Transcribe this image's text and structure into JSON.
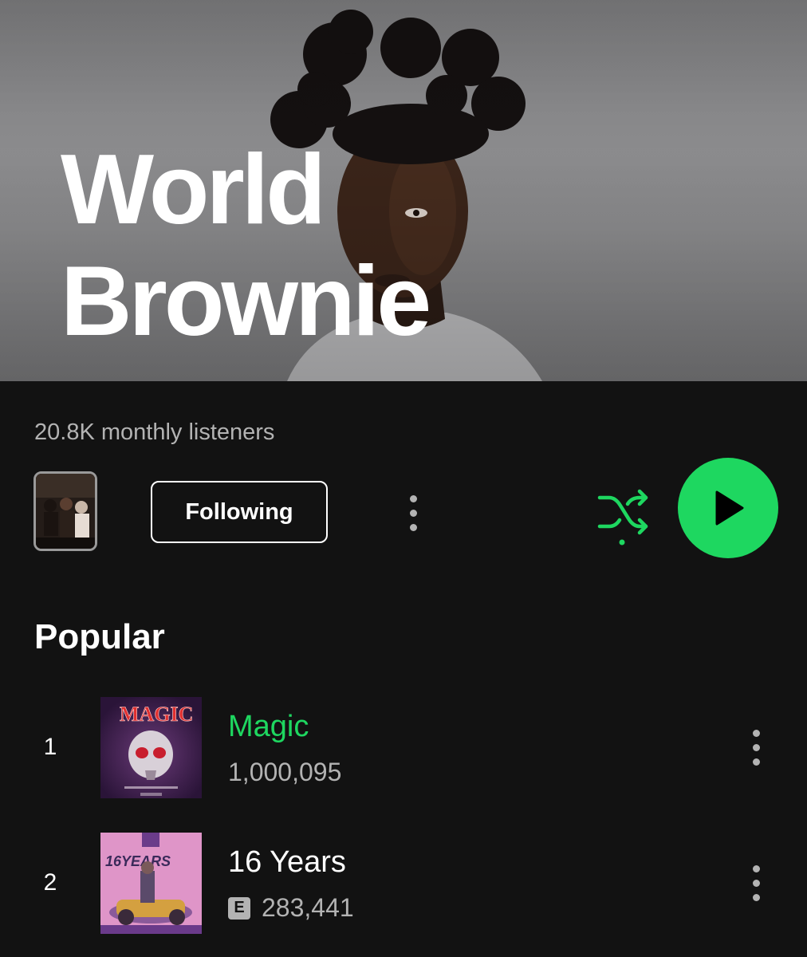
{
  "artist": {
    "name_line1": "World",
    "name_line2": "Brownie",
    "monthly_listeners": "20.8K monthly listeners"
  },
  "actions": {
    "follow_label": "Following",
    "more_icon": "more-vert-icon",
    "shuffle_icon": "shuffle-icon",
    "play_icon": "play-icon"
  },
  "popular": {
    "title": "Popular",
    "tracks": [
      {
        "rank": "1",
        "title": "Magic",
        "plays": "1,000,095",
        "explicit": false,
        "playing": true,
        "art_text": "MAGIC"
      },
      {
        "rank": "2",
        "title": "16 Years",
        "plays": "283,441",
        "explicit": true,
        "explicit_label": "E",
        "playing": false,
        "art_text": "16YEARS"
      }
    ]
  },
  "colors": {
    "background": "#121212",
    "accent": "#1ed760",
    "secondary_text": "#b3b3b3",
    "primary_text": "#ffffff"
  }
}
